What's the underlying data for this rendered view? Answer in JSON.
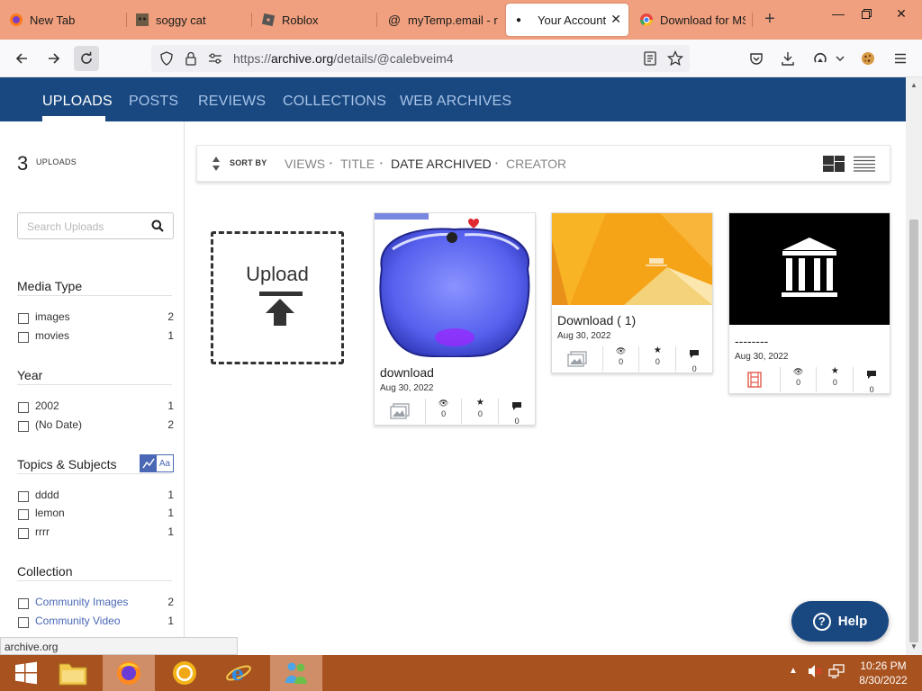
{
  "browser": {
    "tabs": [
      {
        "label": "New Tab",
        "icon": "firefox-icon"
      },
      {
        "label": "soggy cat",
        "icon": "cat-favicon-icon"
      },
      {
        "label": "Roblox",
        "icon": "roblox-icon"
      },
      {
        "label": "myTemp.email - r",
        "icon": "at-sign-icon"
      },
      {
        "label": "Your Account",
        "icon": "dot-icon"
      },
      {
        "label": "Download for MSI",
        "icon": "chrome-icon"
      }
    ],
    "url_prefix": "https://",
    "url_domain": "archive.org",
    "url_path": "/details/@calebveim4"
  },
  "site": {
    "tabs": [
      "UPLOADS",
      "POSTS",
      "REVIEWS",
      "COLLECTIONS",
      "WEB ARCHIVES"
    ],
    "active_tab": "UPLOADS",
    "accent_color": "#194880"
  },
  "sidebar": {
    "upload_count": "3",
    "upload_count_label": "UPLOADS",
    "search_placeholder": "Search Uploads",
    "facets": [
      {
        "title": "Media Type",
        "items": [
          {
            "label": "images",
            "count": "2"
          },
          {
            "label": "movies",
            "count": "1"
          }
        ]
      },
      {
        "title": "Year",
        "items": [
          {
            "label": "2002",
            "count": "1"
          },
          {
            "label": "(No Date)",
            "count": "2"
          }
        ]
      },
      {
        "title": "Topics & Subjects",
        "items": [
          {
            "label": "dddd",
            "count": "1"
          },
          {
            "label": "lemon",
            "count": "1"
          },
          {
            "label": "rrrr",
            "count": "1"
          }
        ]
      },
      {
        "title": "Collection",
        "items": [
          {
            "label": "Community Images",
            "count": "2"
          },
          {
            "label": "Community Video",
            "count": "1"
          }
        ]
      }
    ],
    "topic_toggle_text": "Aa"
  },
  "sort": {
    "label": "SORT BY",
    "options": [
      "VIEWS",
      "TITLE",
      "DATE ARCHIVED",
      "CREATOR"
    ],
    "active": "DATE ARCHIVED"
  },
  "upload_tile": {
    "label": "Upload"
  },
  "items": [
    {
      "title": "download",
      "date": "Aug 30, 2022",
      "media": "image",
      "views": "0",
      "favorites": "0",
      "reviews": "0"
    },
    {
      "title": "Download ( 1)",
      "date": "Aug 30, 2022",
      "media": "image",
      "views": "0",
      "favorites": "0",
      "reviews": "0"
    },
    {
      "title": "--------",
      "date": "Aug 30, 2022",
      "media": "movie",
      "views": "0",
      "favorites": "0",
      "reviews": "0"
    }
  ],
  "help_label": "Help",
  "status_url": "archive.org",
  "clock": {
    "time": "10:26 PM",
    "date": "8/30/2022"
  }
}
